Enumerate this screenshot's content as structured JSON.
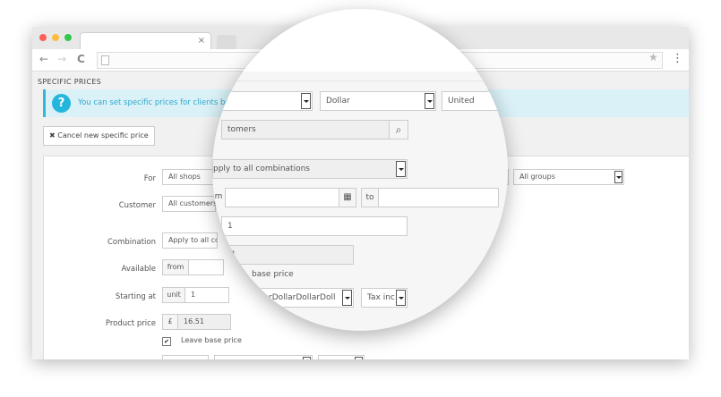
{
  "browser": {
    "tab_close": "×",
    "nav_back": "←",
    "nav_forward": "→",
    "nav_reload": "C",
    "star": "★",
    "menu": "⋮",
    "dot_colors": [
      "#fc605c",
      "#fdbc40",
      "#34c84a"
    ]
  },
  "page": {
    "section_title": "SPECIFIC PRICES",
    "alert_icon": "?",
    "alert_text": "You can set specific prices for clients belonging t",
    "cancel_button": "✖ Cancel new specific price"
  },
  "form": {
    "for_label": "For",
    "for_shop": "All shops",
    "for_group": "All groups",
    "customer_label": "Customer",
    "customer_value": "All customers",
    "combination_label": "Combination",
    "combination_value": "Apply to all con",
    "available_label": "Available",
    "available_from": "from",
    "starting_label": "Starting at",
    "starting_unit": "unit",
    "starting_value": "1",
    "product_price_label": "Product price",
    "currency_symbol": "£",
    "product_price_value": "16.51",
    "leave_base_price": "Leave base price"
  },
  "magnifier": {
    "currency": "Dollar",
    "country": "United",
    "customer_search": "tomers",
    "combination": "pply to all combinations",
    "from_cut": "m",
    "to": "to",
    "starting_value": "1",
    "price_value": "51",
    "leave_base_cut": "base price",
    "currency_repeat": "ollarDollarDollarDoll",
    "tax": "Tax inc",
    "search_icon": "⌕",
    "calendar_icon": "▦"
  }
}
